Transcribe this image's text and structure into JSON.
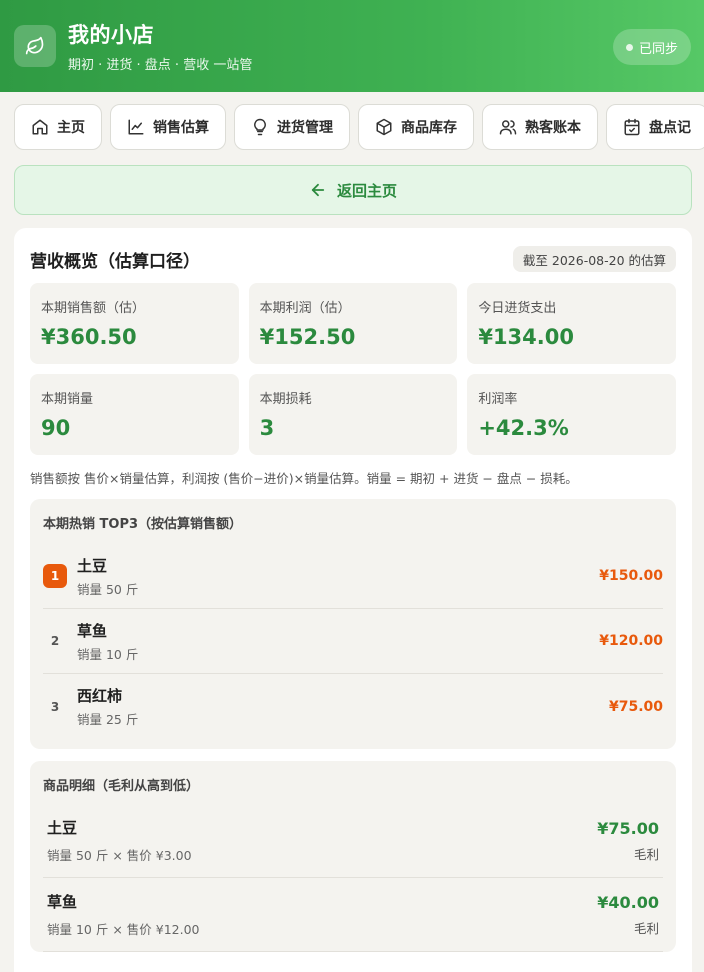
{
  "colors": {
    "brand": "#3fb152",
    "accent_green": "#2b8a3e",
    "accent_orange": "#e8590c"
  },
  "header": {
    "title": "我的小店",
    "subtitle": "期初 · 进货 · 盘点 · 营收 一站管",
    "logo_icon": "leaf-icon",
    "sync_label": "已同步"
  },
  "nav": {
    "items": [
      {
        "label": "主页",
        "icon": "home-icon"
      },
      {
        "label": "销售估算",
        "icon": "line-chart-icon"
      },
      {
        "label": "进货管理",
        "icon": "lightbulb-icon"
      },
      {
        "label": "商品库存",
        "icon": "box-icon"
      },
      {
        "label": "熟客账本",
        "icon": "users-icon"
      },
      {
        "label": "盘点记",
        "icon": "calendar-check-icon"
      }
    ]
  },
  "back": {
    "label": "返回主页",
    "icon": "arrow-left-icon"
  },
  "summary": {
    "title": "营收概览（估算口径）",
    "date_badge": "截至 2026-08-20 的估算",
    "stats": [
      {
        "label": "本期销售额（估）",
        "value": "¥360.50"
      },
      {
        "label": "本期利润（估）",
        "value": "¥152.50"
      },
      {
        "label": "今日进货支出",
        "value": "¥134.00"
      },
      {
        "label": "本期销量",
        "value": "90"
      },
      {
        "label": "本期损耗",
        "value": "3"
      },
      {
        "label": "利润率",
        "value": "+42.3%"
      }
    ],
    "note": "销售额按 售价×销量估算，利润按 (售价−进价)×销量估算。销量 = 期初 + 进货 − 盘点 − 损耗。"
  },
  "top3": {
    "title": "本期热销 TOP3（按估算销售额）",
    "items": [
      {
        "rank": "1",
        "name": "土豆",
        "sub": "销量 50 斤",
        "amount": "¥150.00"
      },
      {
        "rank": "2",
        "name": "草鱼",
        "sub": "销量 10 斤",
        "amount": "¥120.00"
      },
      {
        "rank": "3",
        "name": "西红柿",
        "sub": "销量 25 斤",
        "amount": "¥75.00"
      }
    ]
  },
  "details": {
    "title": "商品明细（毛利从高到低）",
    "items": [
      {
        "name": "土豆",
        "sub": "销量 50 斤 × 售价 ¥3.00",
        "profit": "¥75.00",
        "profit_label": "毛利"
      },
      {
        "name": "草鱼",
        "sub": "销量 10 斤 × 售价 ¥12.00",
        "profit": "¥40.00",
        "profit_label": "毛利"
      }
    ]
  }
}
